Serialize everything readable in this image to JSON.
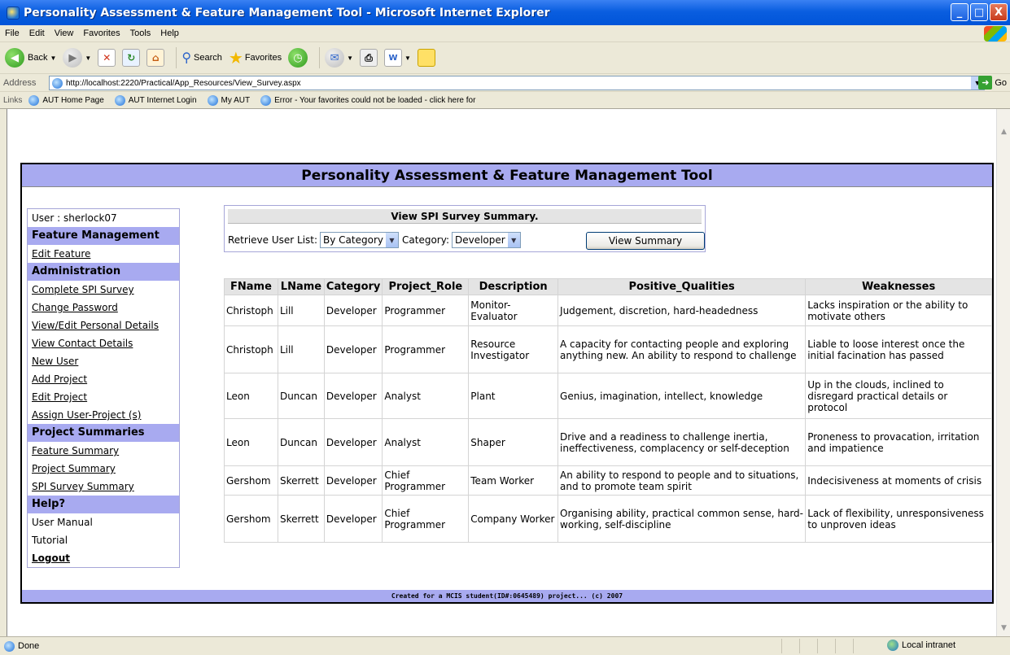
{
  "window": {
    "title": "Personality Assessment & Feature Management Tool - Microsoft Internet Explorer",
    "controls": [
      "_",
      "□",
      "X"
    ]
  },
  "menu": [
    "File",
    "Edit",
    "View",
    "Favorites",
    "Tools",
    "Help"
  ],
  "toolbar": {
    "back": "Back",
    "search": "Search",
    "favorites": "Favorites"
  },
  "address": {
    "label": "Address",
    "url": "http://localhost:2220/Practical/App_Resources/View_Survey.aspx",
    "go": "Go"
  },
  "links": {
    "label": "Links",
    "items": [
      "AUT Home Page",
      "AUT Internet Login",
      "My AUT",
      "Error - Your favorites could not be loaded - click here for"
    ]
  },
  "page": {
    "header": "Personality Assessment & Feature Management Tool",
    "footer": "Created for a MCIS student(ID#:0645489) project... (c) 2007"
  },
  "sidebar": {
    "user": "User : sherlock07",
    "items": [
      {
        "label": "Feature Management",
        "kind": "head"
      },
      {
        "label": "Edit Feature",
        "kind": "link"
      },
      {
        "label": "Administration",
        "kind": "head"
      },
      {
        "label": "Complete SPI Survey",
        "kind": "link"
      },
      {
        "label": "Change Password",
        "kind": "link"
      },
      {
        "label": "View/Edit Personal Details",
        "kind": "link"
      },
      {
        "label": "View Contact Details",
        "kind": "link"
      },
      {
        "label": "New User",
        "kind": "link"
      },
      {
        "label": "Add Project",
        "kind": "link"
      },
      {
        "label": "Edit Project",
        "kind": "link"
      },
      {
        "label": "Assign User-Project (s)",
        "kind": "link"
      },
      {
        "label": "Project Summaries",
        "kind": "head"
      },
      {
        "label": "Feature Summary",
        "kind": "link"
      },
      {
        "label": "Project Summary",
        "kind": "link"
      },
      {
        "label": "SPI Survey Summary",
        "kind": "link"
      },
      {
        "label": "Help?",
        "kind": "head"
      },
      {
        "label": "User Manual",
        "kind": "plain"
      },
      {
        "label": "Tutorial",
        "kind": "plain"
      },
      {
        "label": "Logout",
        "kind": "bold"
      }
    ]
  },
  "survey": {
    "title": "View SPI Survey Summary.",
    "retrieve_label": "Retrieve User List:",
    "retrieve_value": "By Category",
    "category_label": "Category:",
    "category_value": "Developer",
    "button": "View Summary"
  },
  "table": {
    "headers": [
      "FName",
      "LName",
      "Category",
      "Project_Role",
      "Description",
      "Positive_Qualities",
      "Weaknesses"
    ],
    "rows": [
      [
        "Christoph",
        "Lill",
        "Developer",
        "Programmer",
        "Monitor-Evaluator",
        "Judgement, discretion, hard-headedness",
        "Lacks inspiration or the ability to motivate others"
      ],
      [
        "Christoph",
        "Lill",
        "Developer",
        "Programmer",
        "Resource Investigator",
        "A capacity for contacting people and exploring anything new. An ability to respond to challenge",
        "Liable to loose interest once the initial facination has passed"
      ],
      [
        "Leon",
        "Duncan",
        "Developer",
        "Analyst",
        "Plant",
        "Genius, imagination, intellect, knowledge",
        "Up in the clouds, inclined to disregard practical details or protocol"
      ],
      [
        "Leon",
        "Duncan",
        "Developer",
        "Analyst",
        "Shaper",
        "Drive and a readiness to challenge inertia, ineffectiveness, complacency or self-deception",
        "Proneness to provacation, irritation and impatience"
      ],
      [
        "Gershom",
        "Skerrett",
        "Developer",
        "Chief Programmer",
        "Team Worker",
        "An ability to respond to people and to situations, and to promote team spirit",
        "Indecisiveness at moments of crisis"
      ],
      [
        "Gershom",
        "Skerrett",
        "Developer",
        "Chief Programmer",
        "Company Worker",
        "Organising ability, practical common sense, hard-working, self-discipline",
        "Lack of flexibility, unresponsiveness to unproven ideas"
      ]
    ]
  },
  "status": {
    "text": "Done",
    "zone": "Local intranet"
  },
  "colors": {
    "band": "#a8aaf0",
    "xp_title": "#0054d8"
  }
}
